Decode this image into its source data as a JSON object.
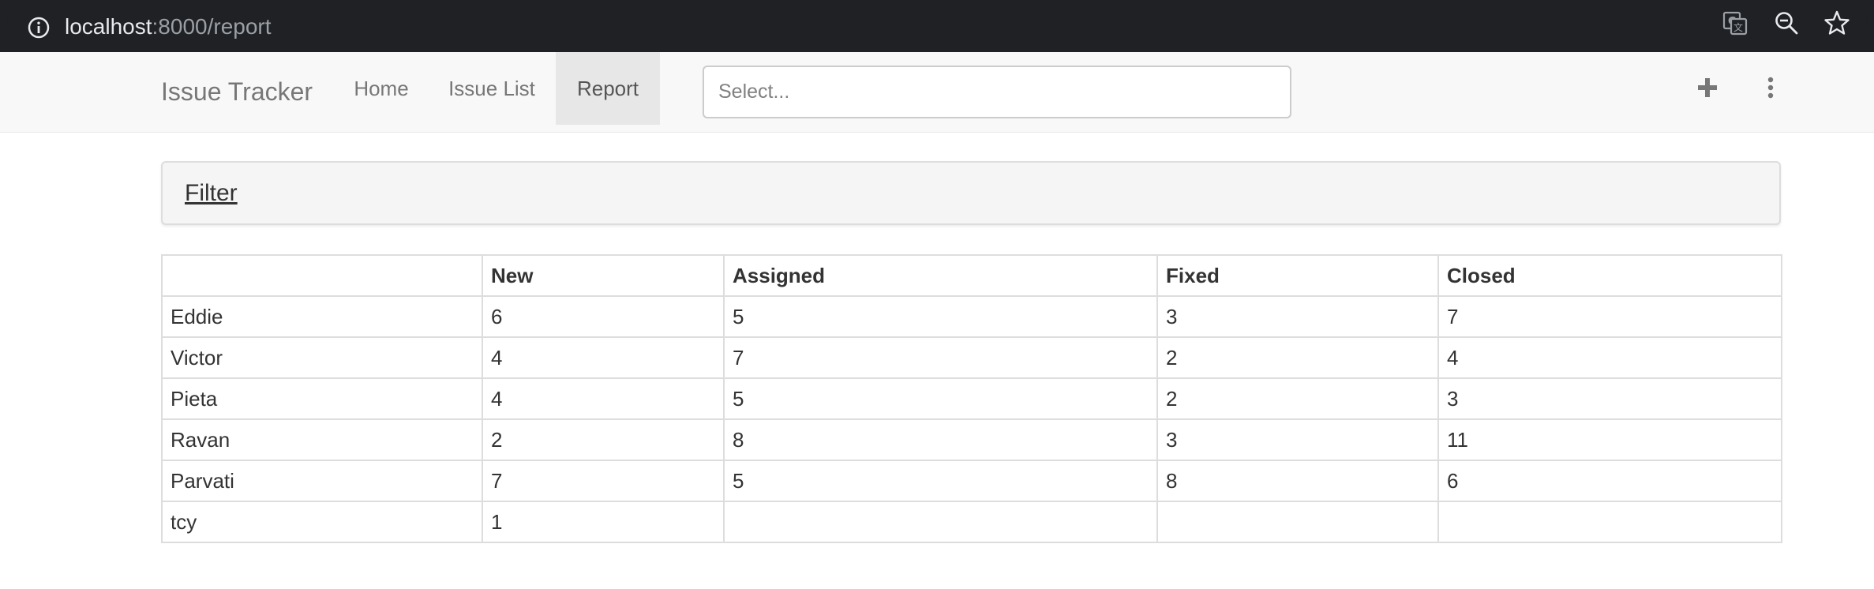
{
  "browser": {
    "url_host": "localhost",
    "url_rest": ":8000/report",
    "icons": [
      "info-icon",
      "translate-icon",
      "zoom-out-icon",
      "bookmark-star-icon"
    ]
  },
  "navbar": {
    "brand": "Issue Tracker",
    "links": [
      {
        "label": "Home",
        "active": false
      },
      {
        "label": "Issue List",
        "active": false
      },
      {
        "label": "Report",
        "active": true
      }
    ],
    "select_placeholder": "Select...",
    "icons": [
      "plus-icon",
      "more-vertical-icon"
    ]
  },
  "filter": {
    "label": "Filter"
  },
  "table": {
    "columns": [
      "",
      "New",
      "Assigned",
      "Fixed",
      "Closed"
    ],
    "rows": [
      [
        "Eddie",
        "6",
        "5",
        "3",
        "7"
      ],
      [
        "Victor",
        "4",
        "7",
        "2",
        "4"
      ],
      [
        "Pieta",
        "4",
        "5",
        "2",
        "3"
      ],
      [
        "Ravan",
        "2",
        "8",
        "3",
        "11"
      ],
      [
        "Parvati",
        "7",
        "5",
        "8",
        "6"
      ],
      [
        "tcy",
        "1",
        "",
        "",
        ""
      ]
    ]
  },
  "colors": {
    "browser_bar": "#202124",
    "navbar_bg": "#f8f8f8",
    "active_tab_bg": "#e7e7e7",
    "panel_bg": "#f5f5f5",
    "border": "#dddddd"
  }
}
